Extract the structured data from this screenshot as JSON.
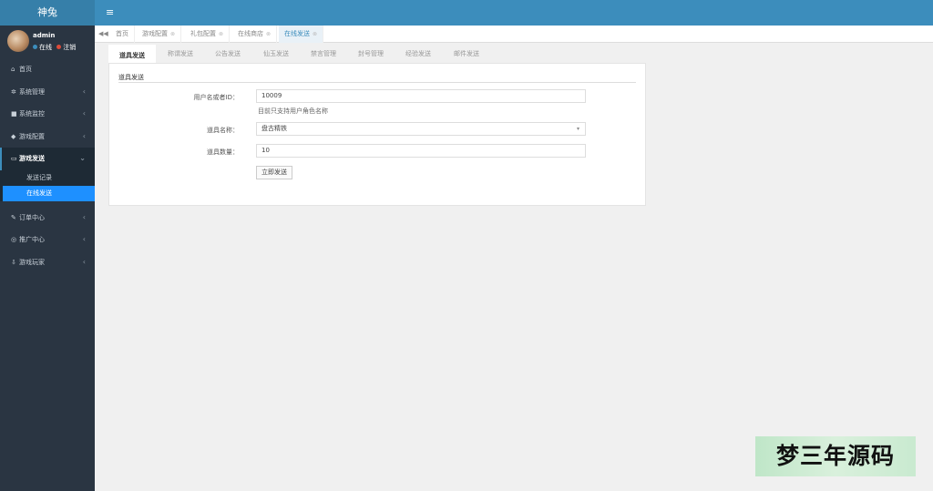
{
  "brand": {
    "title": "神兔"
  },
  "user": {
    "name": "admin",
    "status_online": "在线",
    "status_logout": "注销"
  },
  "menu_toggle_icon": "hamburger-icon",
  "sidebar": {
    "items": [
      {
        "label": "首页",
        "icon": "home-icon"
      },
      {
        "label": "系统管理",
        "icon": "gear-icon"
      },
      {
        "label": "系统监控",
        "icon": "video-icon"
      },
      {
        "label": "游戏配置",
        "icon": "gamepad-icon"
      },
      {
        "label": "游戏发送",
        "icon": "keyboard-icon"
      },
      {
        "label": "订单中心",
        "icon": "pencil-icon"
      },
      {
        "label": "推广中心",
        "icon": "eye-icon"
      },
      {
        "label": "游戏玩家",
        "icon": "download-icon"
      }
    ],
    "subitems": [
      {
        "label": "发送记录"
      },
      {
        "label": "在线发送"
      }
    ]
  },
  "page_tabs": [
    {
      "label": "首页"
    },
    {
      "label": "游戏配置"
    },
    {
      "label": "礼包配置"
    },
    {
      "label": "在线商店"
    },
    {
      "label": "在线发送"
    }
  ],
  "inner_tabs": [
    {
      "label": "道具发送"
    },
    {
      "label": "称谓发送"
    },
    {
      "label": "公告发送"
    },
    {
      "label": "仙玉发送"
    },
    {
      "label": "禁言管理"
    },
    {
      "label": "封号管理"
    },
    {
      "label": "经验发送"
    },
    {
      "label": "邮件发送"
    }
  ],
  "form": {
    "section_title": "道具发送",
    "user_label": "用户名或者ID：",
    "user_value": "10009",
    "user_help": "目前只支持用户角色名称",
    "item_label": "道具名称：",
    "item_value": "盘古精铁",
    "qty_label": "道具数量：",
    "qty_value": "10",
    "submit_label": "立即发送"
  },
  "watermark": "梦三年源码"
}
